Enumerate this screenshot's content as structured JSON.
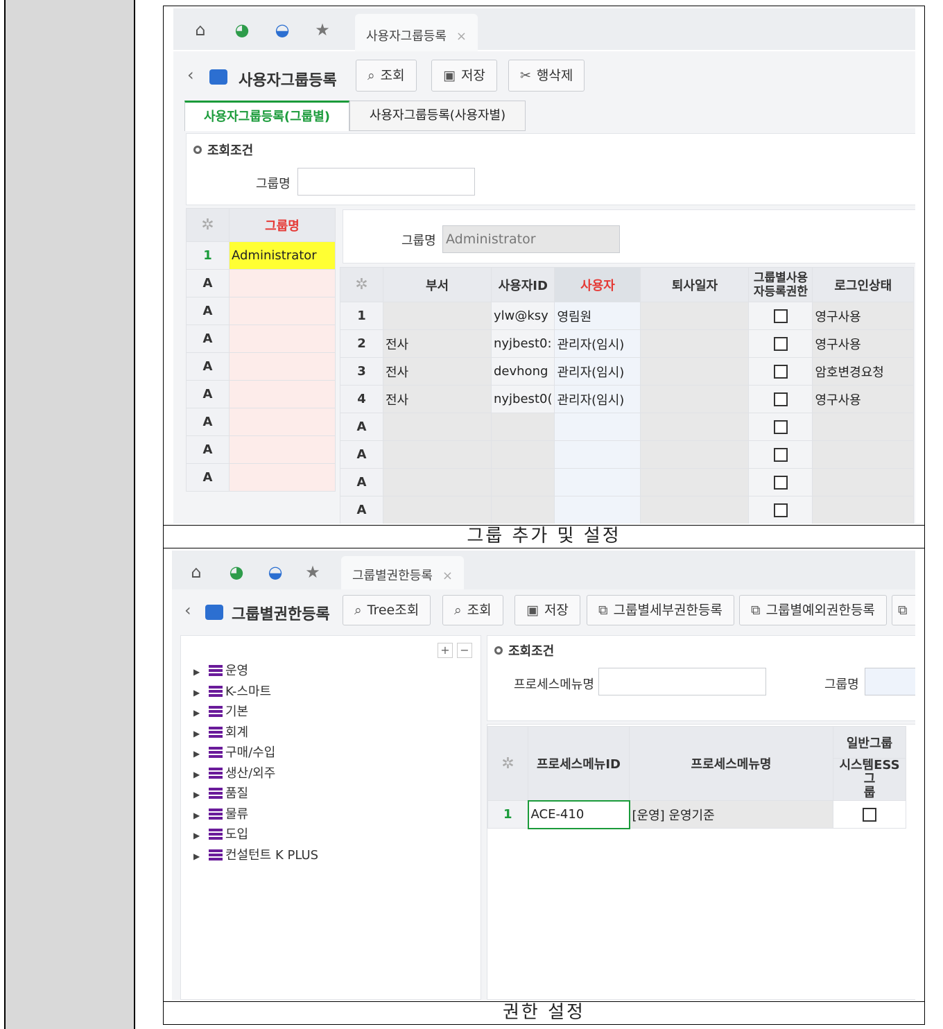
{
  "screen1": {
    "tab": "사용자그룹등록",
    "title": "사용자그룹등록",
    "buttons": {
      "search": "조회",
      "save": "저장",
      "delete_row": "행삭제"
    },
    "subtabs": [
      "사용자그룹등록(그룹별)",
      "사용자그룹등록(사용자별)"
    ],
    "condition_title": "조회조건",
    "group_label": "그룹명",
    "left_grid": {
      "header": "그룹명",
      "rows": [
        {
          "num": "1",
          "name": "Administrator"
        }
      ],
      "empty_marker": "A"
    },
    "detail_label": "그룹명",
    "detail_value": "Administrator",
    "user_grid": {
      "headers": [
        "부서",
        "사용자ID",
        "사용자",
        "퇴사일자",
        "그룹별사용\n자등록권한",
        "로그인상태"
      ],
      "rows": [
        {
          "num": "1",
          "dept": "",
          "userid": "ylw@ksy",
          "user": "영림원",
          "retire": "",
          "status": "영구사용"
        },
        {
          "num": "2",
          "dept": "전사",
          "userid": "nyjbest0:",
          "user": "관리자(임시)",
          "retire": "",
          "status": "영구사용"
        },
        {
          "num": "3",
          "dept": "전사",
          "userid": "devhong",
          "user": "관리자(임시)",
          "retire": "",
          "status": "암호변경요청"
        },
        {
          "num": "4",
          "dept": "전사",
          "userid": "nyjbest0(",
          "user": "관리자(임시)",
          "retire": "",
          "status": "영구사용"
        }
      ],
      "empty_marker": "A"
    }
  },
  "caption1": "그룹 추가 및 설정",
  "screen2": {
    "tab": "그룹별권한등록",
    "title": "그룹별권한등록",
    "buttons": {
      "tree_search": "Tree조회",
      "search": "조회",
      "save": "저장",
      "detail_perm": "그룹별세부권한등록",
      "except_perm": "그룹별예외권한등록"
    },
    "tree": [
      "운영",
      "K-스마트",
      "기본",
      "회계",
      "구매/수입",
      "생산/외주",
      "품질",
      "물류",
      "도입",
      "컨설턴트 K PLUS"
    ],
    "condition_title": "조회조건",
    "process_menu_label": "프로세스메뉴명",
    "group_label": "그룹명",
    "grid": {
      "headers": [
        "프로세스메뉴ID",
        "프로세스메뉴명",
        "일반그룹",
        "시스템ESS그\n룹"
      ],
      "rows": [
        {
          "num": "1",
          "id": "ACE-410",
          "name": "[운영] 운영기준"
        }
      ]
    }
  },
  "caption2": "권한 설정"
}
